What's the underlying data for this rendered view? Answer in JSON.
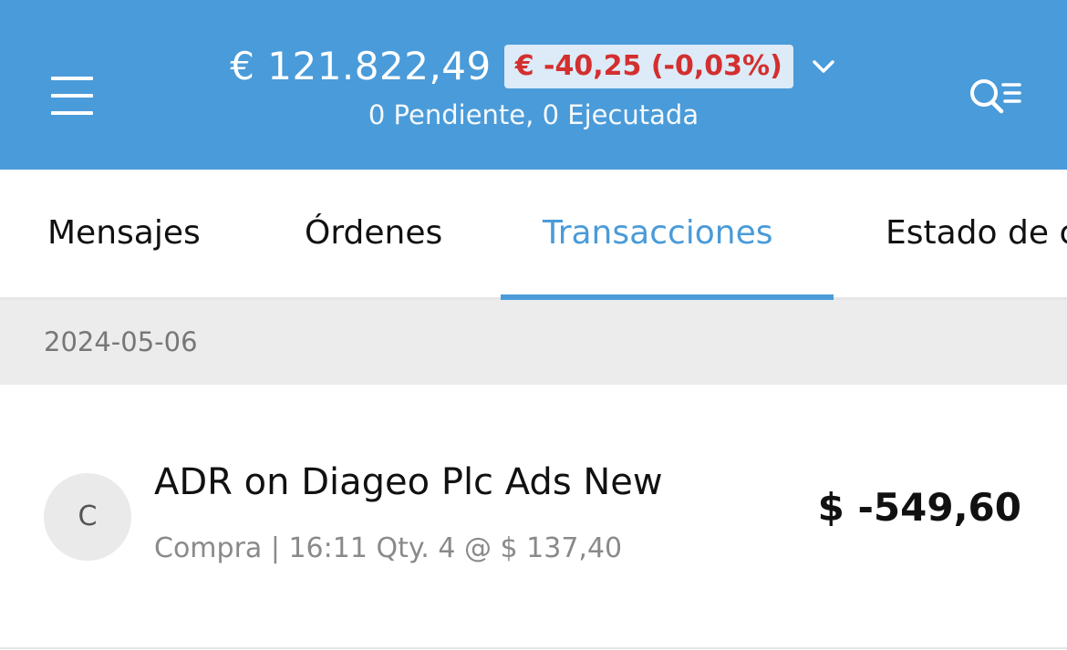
{
  "header": {
    "balance": "€ 121.822,49",
    "change": "€ -40,25 (-0,03%)",
    "subtitle": "0 Pendiente, 0 Ejecutada",
    "colors": {
      "background": "#4a9bd9",
      "change_text": "#d32f2f",
      "change_bg": "#dcebf7"
    },
    "icons": {
      "menu": "hamburger-menu-icon",
      "expand": "chevron-down-icon",
      "search": "search-list-icon"
    }
  },
  "tabs": [
    {
      "label": "Mensajes",
      "active": false
    },
    {
      "label": "Órdenes",
      "active": false
    },
    {
      "label": "Transacciones",
      "active": true
    },
    {
      "label": "Estado de c",
      "active": false
    }
  ],
  "date_header": "2024-05-06",
  "transactions": [
    {
      "avatar": "C",
      "title": "ADR on Diageo Plc Ads New",
      "detail": "Compra | 16:11 Qty. 4 @ $ 137,40",
      "amount": "$ -549,60"
    }
  ]
}
